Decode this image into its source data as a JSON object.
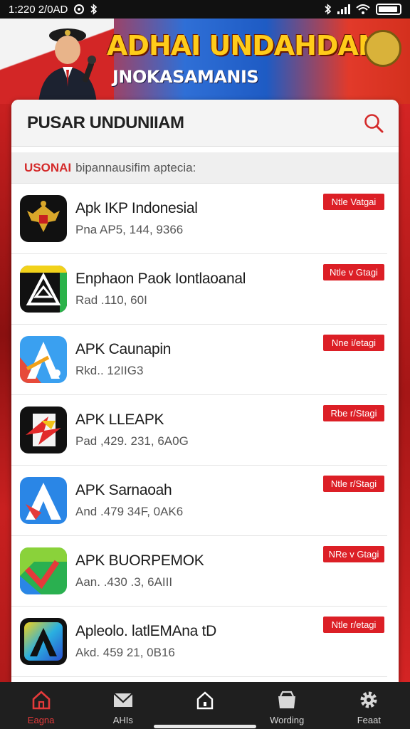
{
  "status_bar": {
    "time": "1:220 2/0AD",
    "colors": {
      "bg": "#111111",
      "fg": "#ffffff"
    }
  },
  "banner": {
    "title": "ADHAI UNDAHDAN",
    "subtitle": "JNOKASAMANIS"
  },
  "header": {
    "title": "PUSAR UNDUNIIAM",
    "search_icon": "search-icon"
  },
  "subheader": {
    "accent": "USONAI",
    "text": "bipannausifim aptecia:"
  },
  "apps": [
    {
      "name": "Apk IKP Indonesial",
      "meta": "Pna AP5, 144, 9366",
      "button": "Ntle Vatgai",
      "icon": "garuda-icon"
    },
    {
      "name": "Enphaon Paok Iontlaoanal",
      "meta": "Rad .110, 60I",
      "button": "Ntle v Gtagi",
      "icon": "triangle-logo-icon"
    },
    {
      "name": "APK Caunapin",
      "meta": "Rkd.. 12IIG3",
      "button": "Nne i/etagi",
      "icon": "blue-a-icon"
    },
    {
      "name": "APK LLEAPK",
      "meta": "Pad ,429. 231, 6A0G",
      "button": "Rbe r/Stagi",
      "icon": "red-star-icon"
    },
    {
      "name": "APK Sarnaoah",
      "meta": "And .479 34F, 0AK6",
      "button": "Ntle r/Stagi",
      "icon": "blue-a-icon"
    },
    {
      "name": "APK BUORPEMOK",
      "meta": "Aan. .430 .3, 6AIII",
      "button": "NRe v Gtagi",
      "icon": "green-arrow-icon"
    },
    {
      "name": "Apleolo. latlEMAna tD",
      "meta": "Akd. 459 21, 0B16",
      "button": "Ntle r/etagi",
      "icon": "gradient-a-icon"
    }
  ],
  "nav": [
    {
      "label": "Eagna",
      "icon": "home-icon",
      "active": true
    },
    {
      "label": "AHIs",
      "icon": "mail-icon",
      "active": false
    },
    {
      "label": "",
      "icon": "house-outline-icon",
      "active": false
    },
    {
      "label": "Wording",
      "icon": "inbox-icon",
      "active": false
    },
    {
      "label": "Feaat",
      "icon": "gear-icon",
      "active": false
    }
  ],
  "colors": {
    "accent": "#dc1f26",
    "card_bg": "#ffffff",
    "nav_bg": "#1f1f1f"
  }
}
